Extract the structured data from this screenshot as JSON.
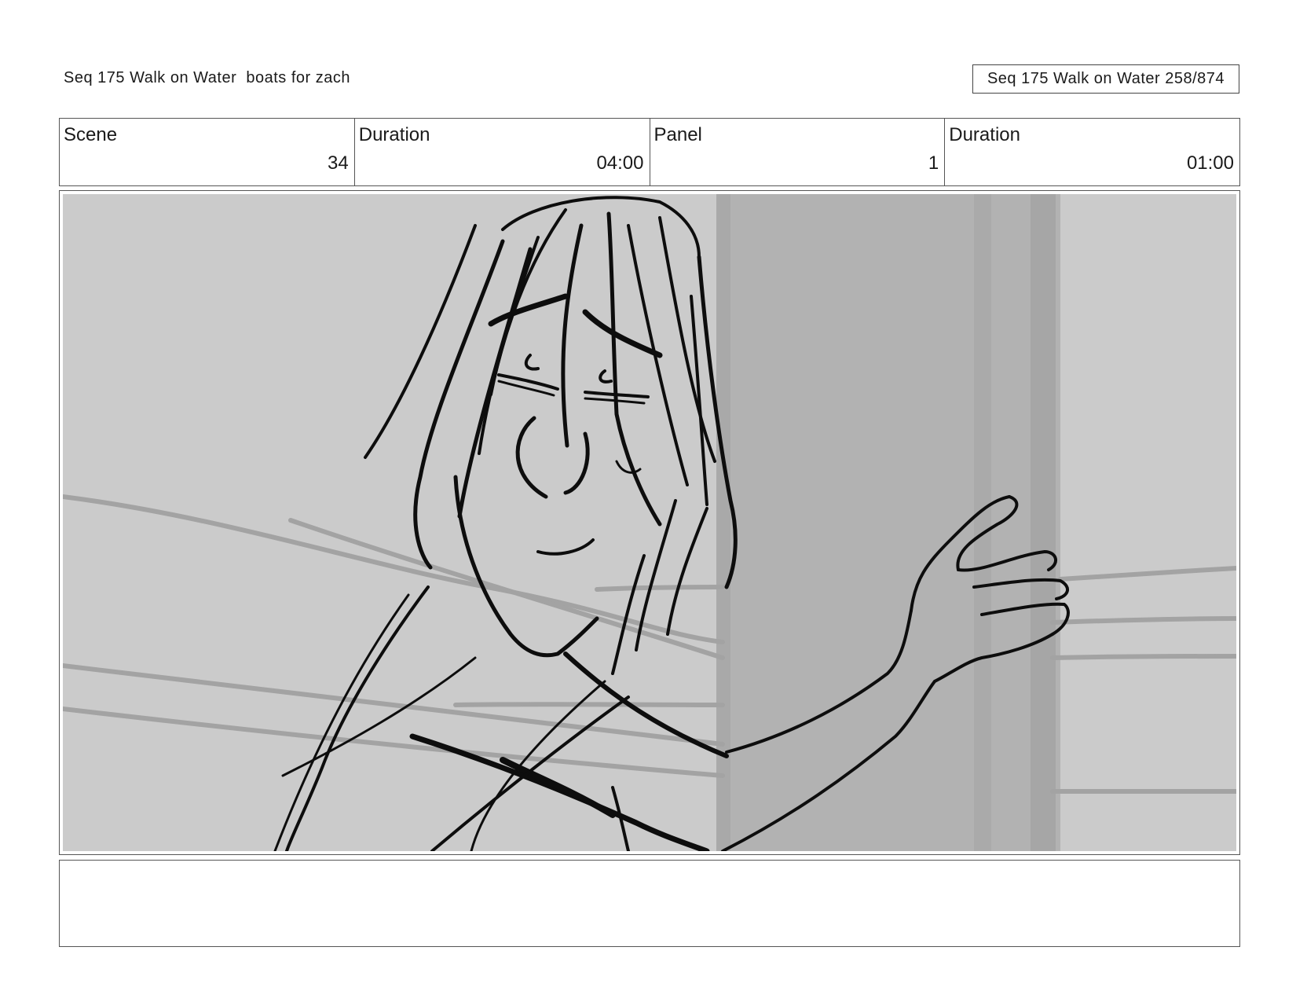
{
  "header": {
    "title": "Seq 175 Walk on Water  boats for zach",
    "page_ref": "Seq 175 Walk on Water 258/874"
  },
  "info": {
    "scene_label": "Scene",
    "scene_value": "34",
    "scene_duration_label": "Duration",
    "scene_duration_value": "04:00",
    "panel_label": "Panel",
    "panel_value": "1",
    "panel_duration_label": "Duration",
    "panel_duration_value": "01:00"
  },
  "panel": {
    "description": "sketch-of-girl-waving",
    "background_color": "#cbcbcb",
    "door_color": "#b2b2b2",
    "line_color": "#0d0d0d"
  },
  "notes": {
    "text": ""
  }
}
